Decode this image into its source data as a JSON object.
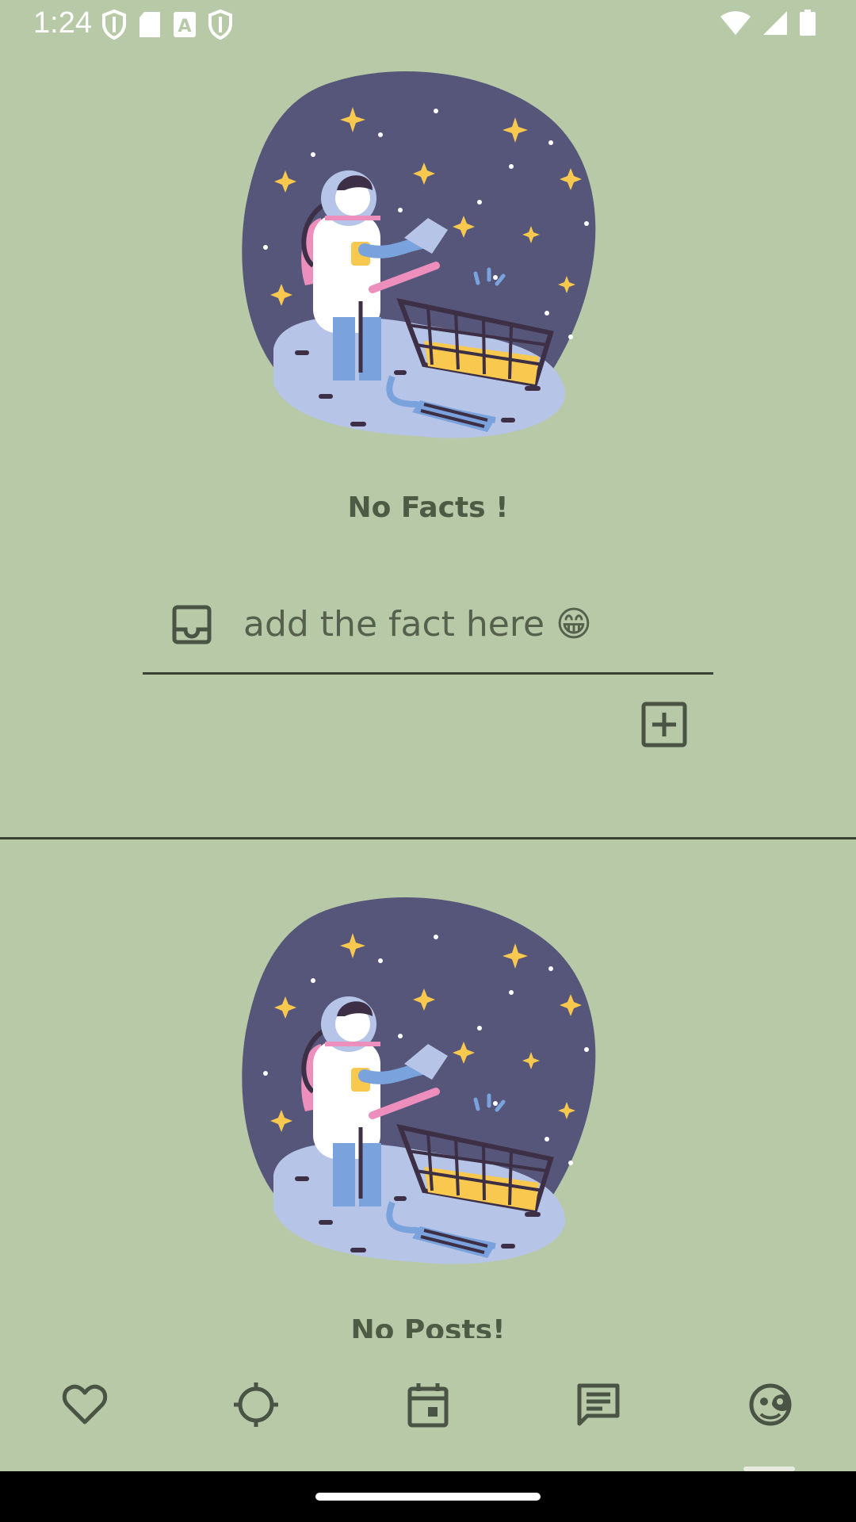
{
  "status_bar": {
    "time": "1:24"
  },
  "facts": {
    "empty_title": "No Facts !",
    "input_placeholder": "add the fact here 😁"
  },
  "posts": {
    "empty_title": "No Posts!"
  },
  "bottom_nav": {
    "items": [
      {
        "icon": "heart-icon"
      },
      {
        "icon": "crosshair-icon"
      },
      {
        "icon": "calendar-icon"
      },
      {
        "icon": "chat-icon"
      },
      {
        "icon": "face-icon"
      }
    ]
  },
  "colors": {
    "background": "#b8c9a7",
    "text": "#4d5a44",
    "icons": "#4a5444"
  }
}
